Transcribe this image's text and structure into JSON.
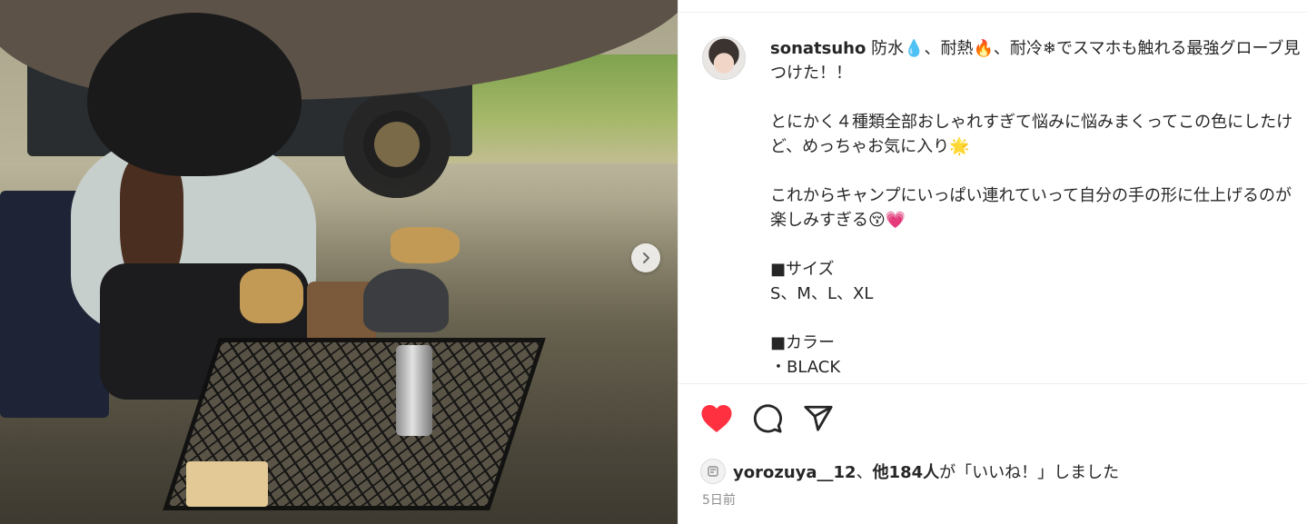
{
  "post": {
    "username": "sonatsuho",
    "caption_lines": [
      " 防水💧、耐熱🔥、耐冷❄でスマホも触れる最強グローブ見つけた！！",
      "",
      "とにかく４種類全部おしゃれすぎて悩みに悩みまくってこの色にしたけど、めっちゃお気に入り🌟",
      "",
      "これからキャンプにいっぱい連れていって自分の手の形に仕上げるのが楽しみすぎる😚💗",
      "",
      "■サイズ",
      "S、M、L、XL",
      "",
      "■カラー",
      "・BLACK"
    ]
  },
  "photo": {
    "next_icon": "chevron-right-icon",
    "alt_visual": "outdoor-camp-photo"
  },
  "actions": {
    "like_icon": "heart-filled-icon",
    "comment_icon": "comment-icon",
    "share_icon": "share-icon",
    "like_color": "#ff3040"
  },
  "likes": {
    "liker": "yorozuya__12",
    "sep": "、",
    "others": "他184人",
    "suffix": "が「いいね！」しました"
  },
  "time_ago": "5日前"
}
